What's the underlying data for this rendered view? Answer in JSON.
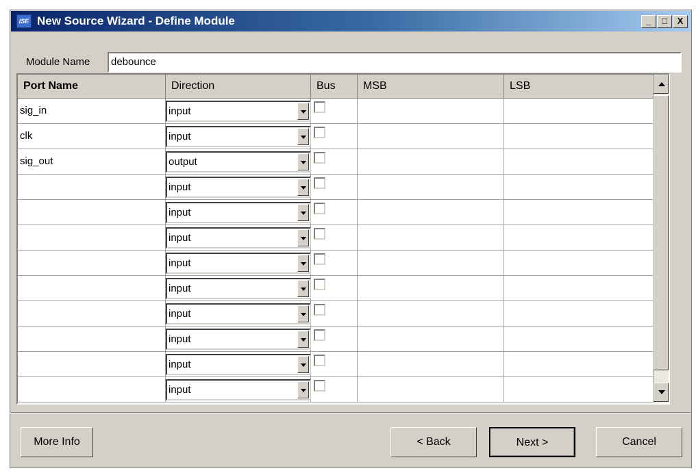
{
  "window": {
    "title": "New Source Wizard - Define Module",
    "app_icon_label": "ISE",
    "controls": {
      "minimize": "_",
      "maximize": "□",
      "close": "X"
    }
  },
  "module": {
    "label": "Module Name",
    "value": "debounce"
  },
  "table": {
    "columns": [
      "Port Name",
      "Direction",
      "Bus",
      "MSB",
      "LSB"
    ],
    "rows": [
      {
        "port": "sig_in",
        "direction": "input",
        "bus": false,
        "msb": "",
        "lsb": ""
      },
      {
        "port": "clk",
        "direction": "input",
        "bus": false,
        "msb": "",
        "lsb": ""
      },
      {
        "port": "sig_out",
        "direction": "output",
        "bus": false,
        "msb": "",
        "lsb": ""
      },
      {
        "port": "",
        "direction": "input",
        "bus": false,
        "msb": "",
        "lsb": ""
      },
      {
        "port": "",
        "direction": "input",
        "bus": false,
        "msb": "",
        "lsb": ""
      },
      {
        "port": "",
        "direction": "input",
        "bus": false,
        "msb": "",
        "lsb": ""
      },
      {
        "port": "",
        "direction": "input",
        "bus": false,
        "msb": "",
        "lsb": ""
      },
      {
        "port": "",
        "direction": "input",
        "bus": false,
        "msb": "",
        "lsb": ""
      },
      {
        "port": "",
        "direction": "input",
        "bus": false,
        "msb": "",
        "lsb": ""
      },
      {
        "port": "",
        "direction": "input",
        "bus": false,
        "msb": "",
        "lsb": ""
      },
      {
        "port": "",
        "direction": "input",
        "bus": false,
        "msb": "",
        "lsb": ""
      },
      {
        "port": "",
        "direction": "input",
        "bus": false,
        "msb": "",
        "lsb": ""
      }
    ]
  },
  "buttons": {
    "more_info": "More Info",
    "back": "< Back",
    "next": "Next >",
    "cancel": "Cancel"
  },
  "colors": {
    "title_start": "#0a246a",
    "title_end": "#a6caf0",
    "face": "#d4d0c8"
  }
}
